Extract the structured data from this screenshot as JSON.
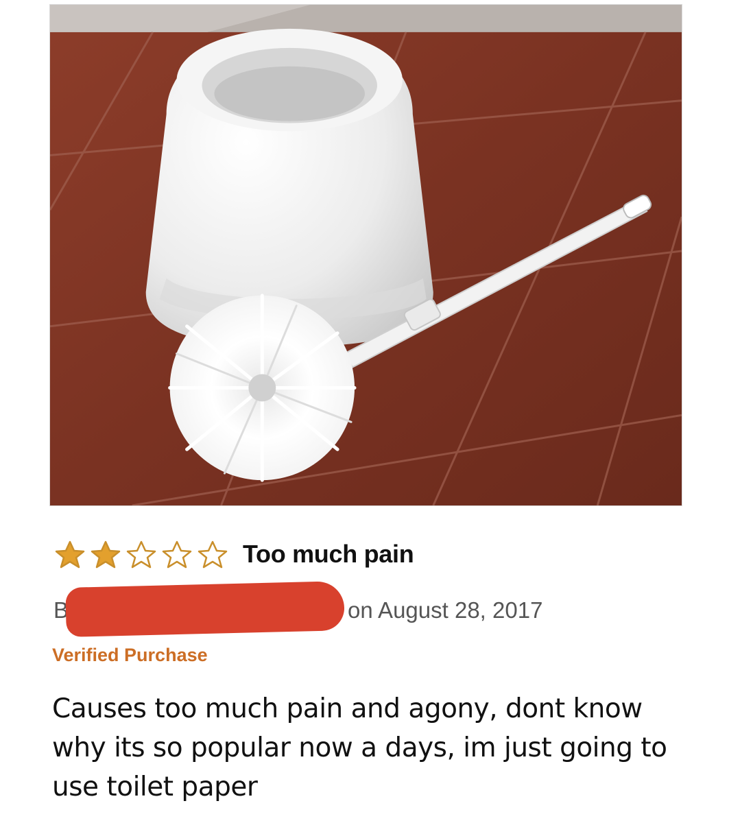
{
  "review": {
    "rating": 2,
    "rating_max": 5,
    "title": "Too much pain",
    "author_visible": "B",
    "date_text": "on August 28, 2017",
    "badge": "Verified Purchase",
    "body": "Causes too much pain and agony, dont know why its so popular now a days, im just going to use toilet paper"
  },
  "icons": {
    "filled_star": "star-filled-icon",
    "empty_star": "star-empty-icon"
  },
  "colors": {
    "star_fill": "#e3a02d",
    "star_outline": "#c98f2b",
    "redaction": "#d8412d",
    "verified": "#c45500",
    "floor_tile": "#7a3424"
  }
}
